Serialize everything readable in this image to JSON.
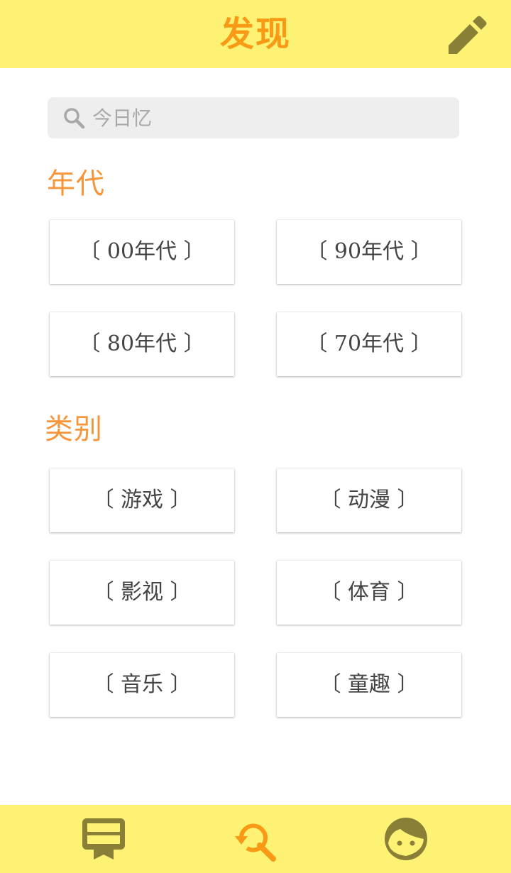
{
  "header": {
    "title": "发现",
    "edit_icon": "pencil-icon"
  },
  "search": {
    "placeholder": "今日忆",
    "icon": "search-icon"
  },
  "era_section": {
    "title": "年代",
    "items": [
      {
        "label": "〔 00年代 〕"
      },
      {
        "label": "〔 90年代 〕"
      },
      {
        "label": "〔 80年代 〕"
      },
      {
        "label": "〔 70年代 〕"
      }
    ]
  },
  "category_section": {
    "title": "类别",
    "items": [
      {
        "label": "〔 游戏 〕"
      },
      {
        "label": "〔 动漫 〕"
      },
      {
        "label": "〔 影视 〕"
      },
      {
        "label": "〔 体育 〕"
      },
      {
        "label": "〔 音乐 〕"
      },
      {
        "label": "〔 童趣 〕"
      }
    ]
  },
  "tabbar": {
    "tabs": [
      {
        "icon": "bookmark-board-icon",
        "active": false
      },
      {
        "icon": "discover-search-icon",
        "active": true
      },
      {
        "icon": "face-profile-icon",
        "active": false
      }
    ]
  },
  "colors": {
    "bar_background": "#fef274",
    "accent_orange": "#f99a16",
    "section_orange": "#f7953a",
    "icon_olive": "#8a7f36",
    "card_text": "#444444",
    "search_background": "#eeeeee"
  }
}
